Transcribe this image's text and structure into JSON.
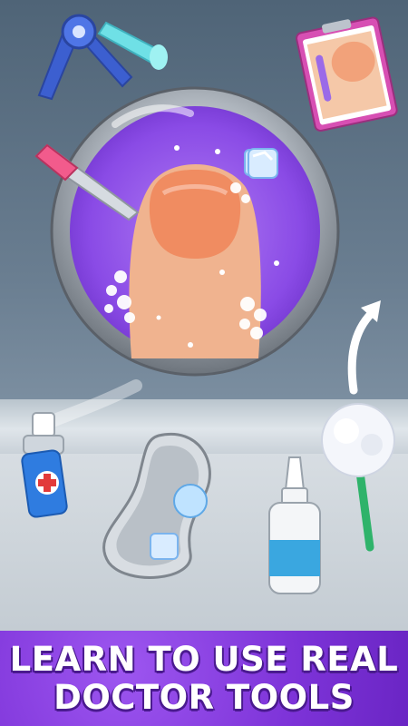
{
  "banner": {
    "line1": "LEARN TO USE REAL",
    "line2": "DOCTOR TOOLS"
  },
  "colors": {
    "banner": "#7d33d8",
    "wall": "#5e7286",
    "lens_purple": "#8a4be6",
    "metal": "#c9ced4",
    "skin": "#f0b38f",
    "nail": "#f08c61",
    "spray_blue": "#2f7ce0",
    "cross_red": "#e23a3a"
  },
  "tools": [
    {
      "icon": "tweezers-icon"
    },
    {
      "icon": "clipboard-photo-icon"
    },
    {
      "icon": "nail-file-icon"
    },
    {
      "icon": "magnifier-lens-icon"
    },
    {
      "icon": "ice-cube-icon"
    },
    {
      "icon": "antiseptic-spray-icon"
    },
    {
      "icon": "kidney-tray-icon"
    },
    {
      "icon": "dropper-bottle-icon"
    },
    {
      "icon": "cotton-swab-icon"
    },
    {
      "icon": "curved-arrow-icon"
    }
  ]
}
